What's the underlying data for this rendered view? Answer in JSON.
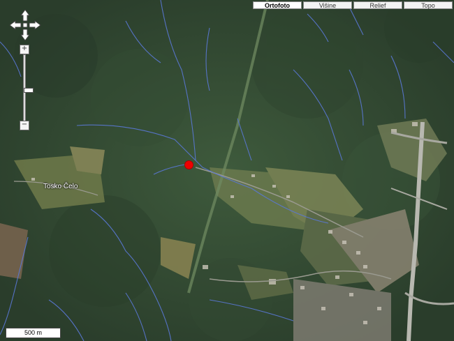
{
  "map": {
    "map_types": [
      "Ortofoto",
      "Višine",
      "Relief",
      "Topo"
    ],
    "active_map_type": "Ortofoto",
    "place_label": "Tosko Čelo",
    "scale_label": "500 m",
    "marker_color": "#ee0000",
    "zoom": {
      "plus": "+",
      "minus": "−"
    }
  }
}
